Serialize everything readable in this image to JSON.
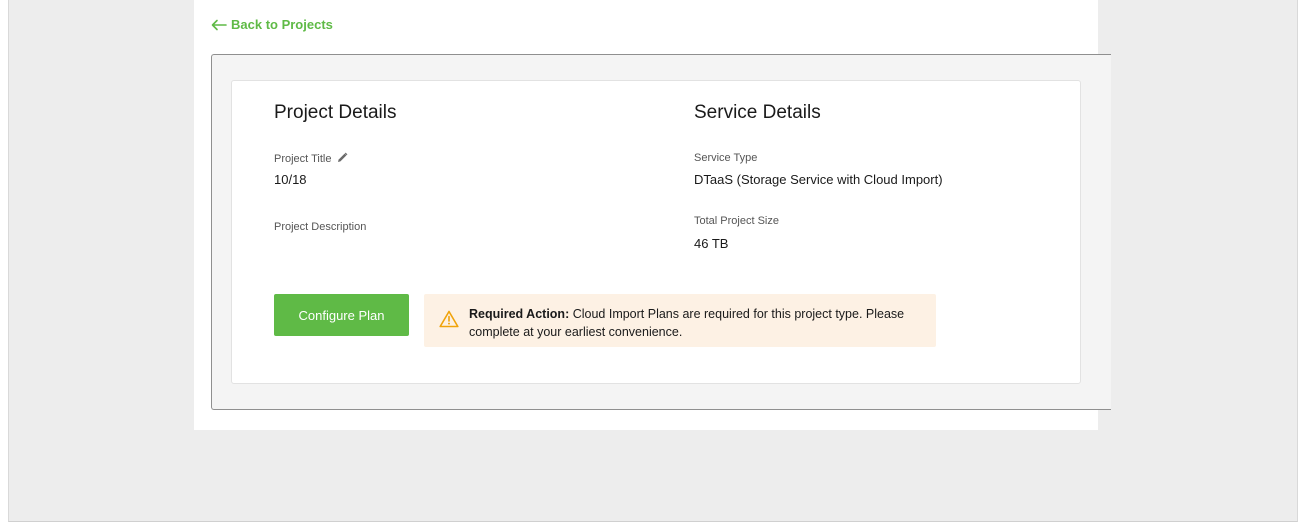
{
  "nav": {
    "back_label": "Back to Projects"
  },
  "project": {
    "heading": "Project Details",
    "title_label": "Project Title",
    "title_value": "10/18",
    "description_label": "Project Description",
    "description_value": ""
  },
  "service": {
    "heading": "Service Details",
    "type_label": "Service Type",
    "type_value": "DTaaS (Storage Service with Cloud Import)",
    "size_label": "Total Project Size",
    "size_value": "46 TB"
  },
  "actions": {
    "configure_label": "Configure Plan"
  },
  "alert": {
    "title": "Required Action:",
    "message": " Cloud Import Plans are required for this project type. Please complete at your earliest convenience."
  },
  "colors": {
    "accent": "#5fba46",
    "alert_bg": "#fdf1e4",
    "warning": "#f0a30a"
  },
  "icons": {
    "back": "arrow-left-icon",
    "edit": "pencil-icon",
    "warning": "warning-triangle-icon"
  }
}
